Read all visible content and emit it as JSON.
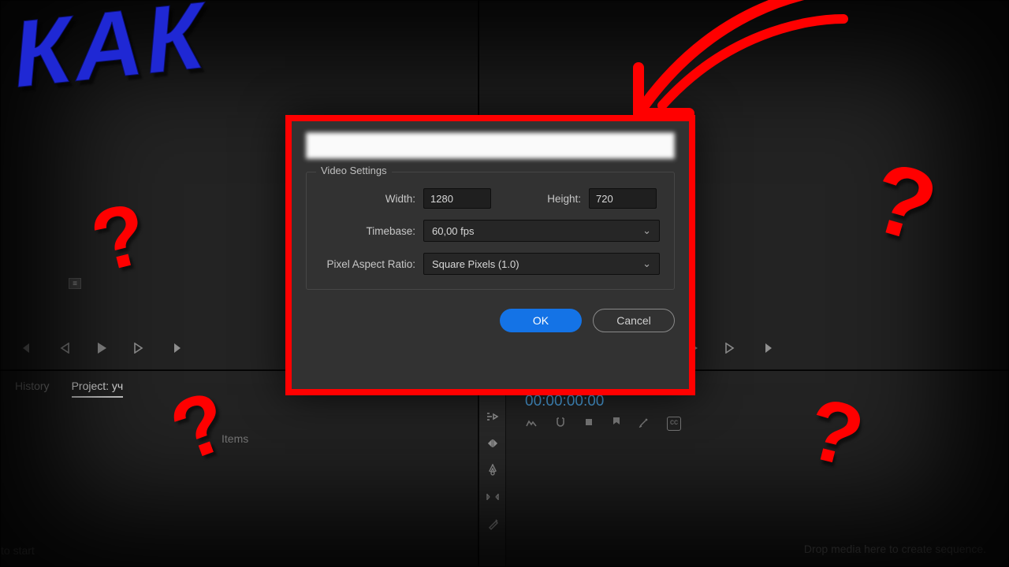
{
  "annotations": {
    "title": "КАК",
    "question": "?"
  },
  "dialog": {
    "legend": "Video Settings",
    "width_label": "Width:",
    "width_value": "1280",
    "height_label": "Height:",
    "height_value": "720",
    "timebase_label": "Timebase:",
    "timebase_value": "60,00 fps",
    "par_label": "Pixel Aspect Ratio:",
    "par_value": "Square Pixels (1.0)",
    "ok_label": "OK",
    "cancel_label": "Cancel"
  },
  "bottom_left": {
    "tab_history": "History",
    "tab_project_prefix": "Project: уч",
    "more": "»",
    "items_label": "Items",
    "hint": "to start"
  },
  "timeline": {
    "timecode": "00:00:00:00",
    "drop_hint": "Drop media here to create sequence."
  }
}
